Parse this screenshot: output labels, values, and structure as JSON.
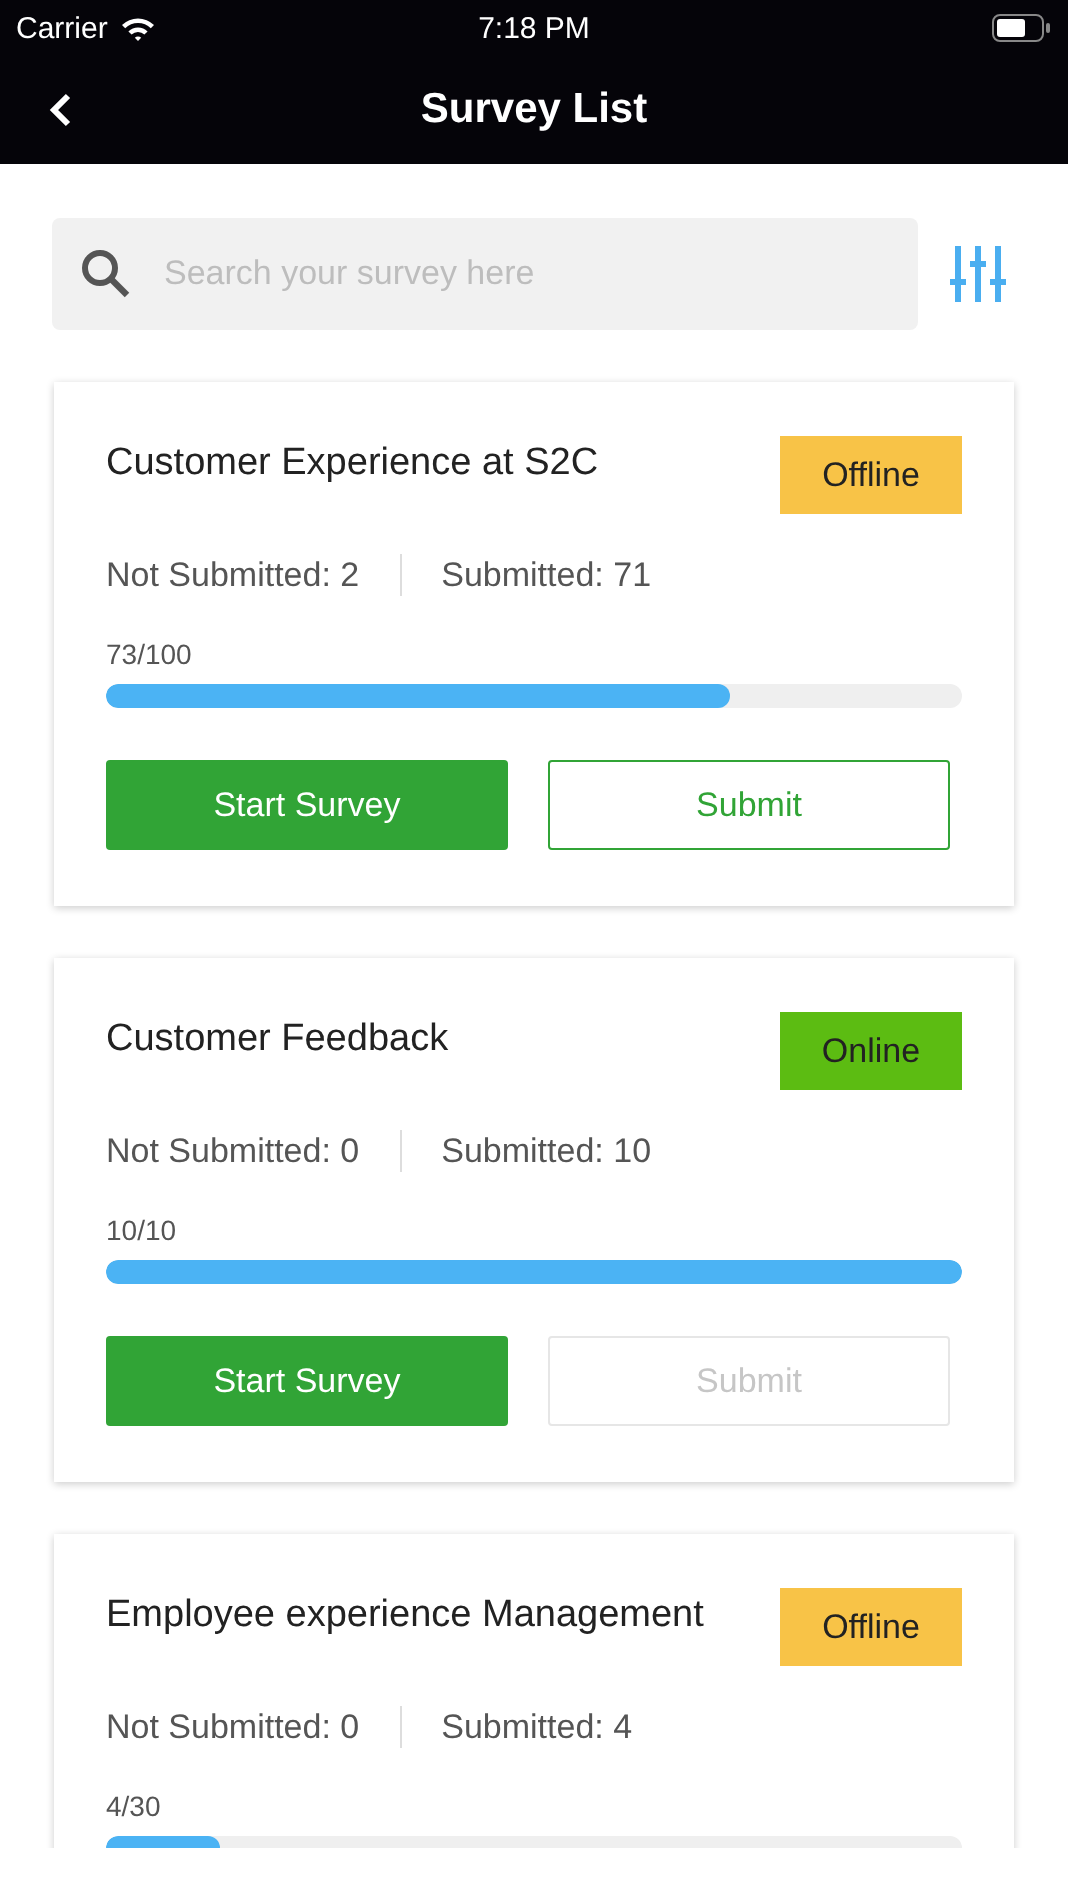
{
  "status_bar": {
    "carrier": "Carrier",
    "time": "7:18 PM"
  },
  "nav": {
    "title": "Survey List"
  },
  "search": {
    "placeholder": "Search your survey here"
  },
  "surveys": [
    {
      "title": "Customer Experience at S2C",
      "status": {
        "kind": "offline",
        "label": "Offline"
      },
      "not_submitted": "Not Submitted: 2",
      "submitted": "Submitted: 71",
      "progress": "73/100",
      "level": 0.73,
      "start_label": "Start Survey",
      "submit_label": "Submit",
      "submit_disabled": false
    },
    {
      "title": "Customer Feedback",
      "status": {
        "kind": "online",
        "label": "Online"
      },
      "not_submitted": "Not Submitted: 0",
      "submitted": "Submitted: 10",
      "progress": "10/10",
      "level": 1,
      "start_label": "Start Survey",
      "submit_label": "Submit",
      "submit_disabled": true
    },
    {
      "title": "Employee experience Management",
      "status": {
        "kind": "offline",
        "label": "Offline"
      },
      "not_submitted": "Not Submitted: 0",
      "submitted": "Submitted: 4",
      "progress": "4/30",
      "level": 0.133
    }
  ]
}
